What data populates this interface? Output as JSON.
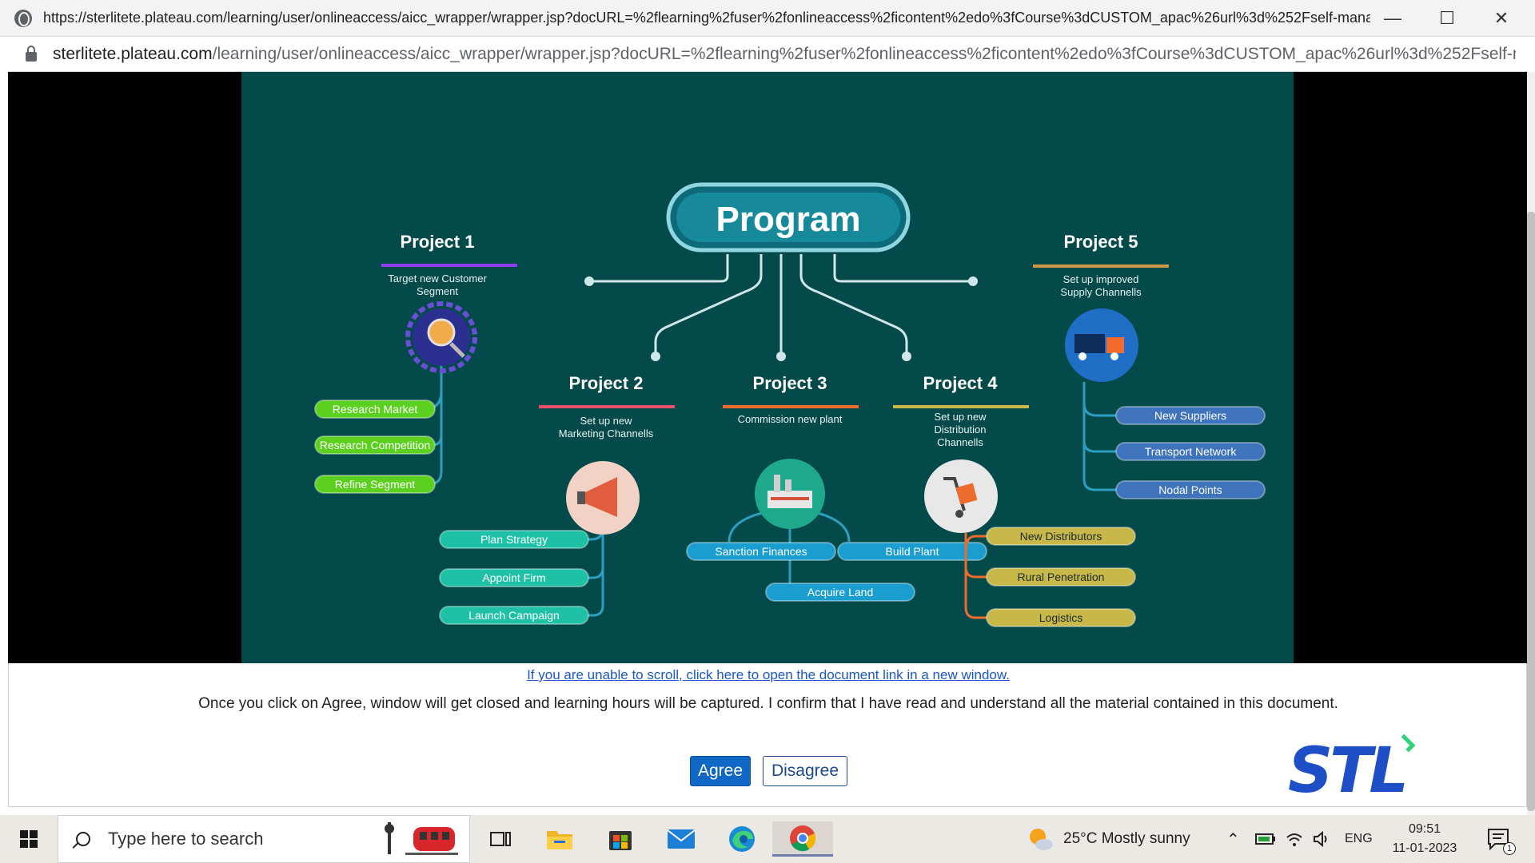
{
  "browser": {
    "title_url": "https://sterlitete.plateau.com/learning/user/onlineaccess/aicc_wrapper/wrapper.jsp?docURL=%2flearning%2fuser%2fonlineaccess%2ficontent%2edo%3fCourse%3dCUSTOM_apac%26url%3d%252Fself-mana...",
    "address_host": "sterlitete.plateau.com",
    "address_path": "/learning/user/onlineaccess/aicc_wrapper/wrapper.jsp?docURL=%2flearning%2fuser%2fonlineaccess%2ficontent%2edo%3fCourse%3dCUSTOM_apac%26url%3d%252Fself-m..."
  },
  "diagram": {
    "program": "Program",
    "projects": [
      {
        "title": "Project 1",
        "subtitle": [
          "Target new Customer",
          "Segment"
        ],
        "color": "#8e3cf0",
        "pill_color": "#5bd01f",
        "items": [
          "Research Market",
          "Research Competition",
          "Refine Segment"
        ],
        "icon": "customer-search-icon"
      },
      {
        "title": "Project 2",
        "subtitle": [
          "Set up new",
          "Marketing Channells"
        ],
        "color": "#e8506a",
        "pill_color": "#1fc1a6",
        "items": [
          "Plan Strategy",
          "Appoint Firm",
          "Launch Campaign"
        ],
        "icon": "megaphone-icon"
      },
      {
        "title": "Project 3",
        "subtitle": [
          "Commission new plant"
        ],
        "color": "#ec6b2d",
        "pill_color": "#1a9ed0",
        "items": [
          "Sanction Finances",
          "Build Plant",
          "Acquire Land"
        ],
        "icon": "factory-icon"
      },
      {
        "title": "Project 4",
        "subtitle": [
          "Set up new",
          "Distribution",
          "Channells"
        ],
        "color": "#c8b84a",
        "pill_color": "#c8b84a",
        "items": [
          "New Distributors",
          "Rural Penetration",
          "Logistics"
        ],
        "icon": "hand-truck-icon"
      },
      {
        "title": "Project 5",
        "subtitle": [
          "Set up improved",
          "Supply Channells"
        ],
        "color": "#c89a4a",
        "pill_color": "#3f74bd",
        "items": [
          "New Suppliers",
          "Transport Network",
          "Nodal Points"
        ],
        "icon": "truck-icon"
      }
    ]
  },
  "footer": {
    "link": "If you are unable to scroll, click here to open the document link in a new window.",
    "message": "Once you click on Agree, window will get closed and learning hours will be captured. I confirm that I have read and understand all the material contained in this document.",
    "agree": "Agree",
    "disagree": "Disagree",
    "logo": "STL"
  },
  "taskbar": {
    "search_placeholder": "Type here to search",
    "weather": "25°C  Mostly sunny",
    "language": "ENG",
    "time": "09:51",
    "date": "11-01-2023",
    "notifications": "1"
  }
}
